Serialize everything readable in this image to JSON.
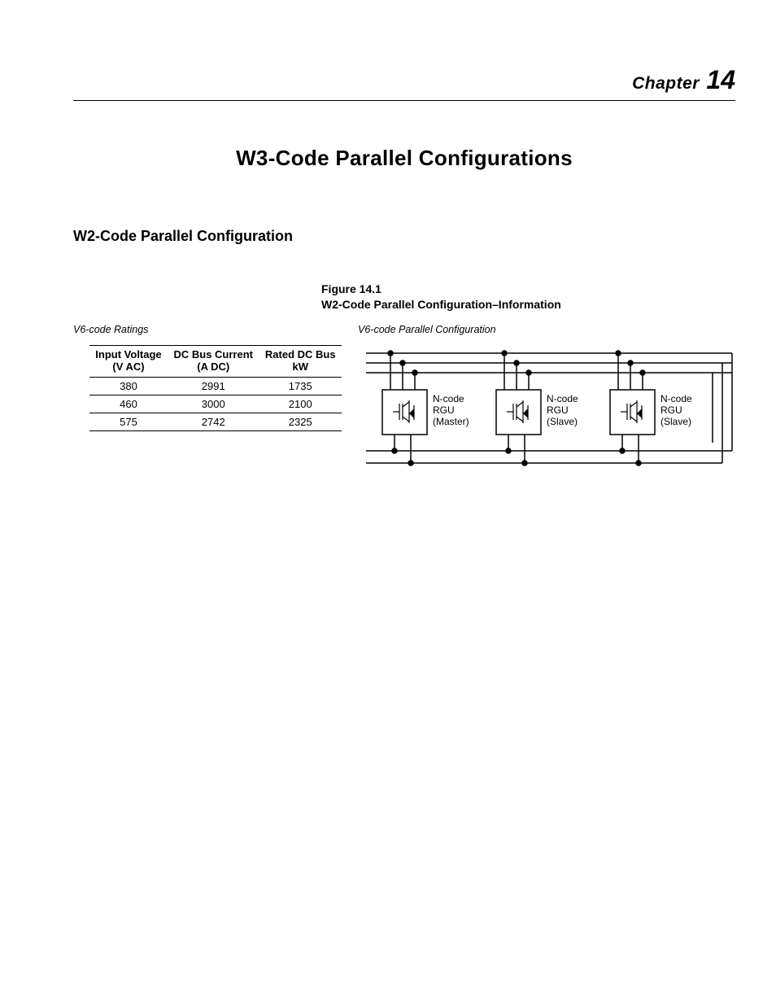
{
  "chapter": {
    "word": "Chapter",
    "number": "14"
  },
  "page_title": "W3-Code Parallel Configurations",
  "section_heading": "W2-Code Parallel Configuration",
  "figure": {
    "number": "Figure 14.1",
    "caption": "W2-Code Parallel Configuration–Information"
  },
  "left_panel": {
    "subhead": "V6-code Ratings",
    "table": {
      "columns": [
        {
          "line1": "Input Voltage",
          "line2": "(V AC)"
        },
        {
          "line1": "DC Bus Current",
          "line2": "(A DC)"
        },
        {
          "line1": "Rated DC Bus",
          "line2": "kW"
        }
      ],
      "rows": [
        [
          "380",
          "2991",
          "1735"
        ],
        [
          "460",
          "3000",
          "2100"
        ],
        [
          "575",
          "2742",
          "2325"
        ]
      ]
    }
  },
  "right_panel": {
    "subhead": "V6-code Parallel Configuration",
    "rgu": [
      {
        "l1": "N-code",
        "l2": "RGU",
        "l3": "(Master)"
      },
      {
        "l1": "N-code",
        "l2": "RGU",
        "l3": "(Slave)"
      },
      {
        "l1": "N-code",
        "l2": "RGU",
        "l3": "(Slave)"
      }
    ]
  }
}
